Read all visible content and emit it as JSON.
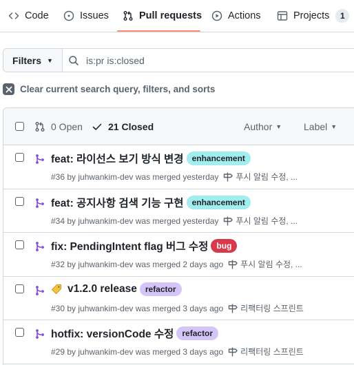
{
  "nav": {
    "tabs": [
      {
        "label": "Code",
        "icon": "code-icon"
      },
      {
        "label": "Issues",
        "icon": "issue-opened-icon"
      },
      {
        "label": "Pull requests",
        "icon": "git-pull-request-icon",
        "active": true
      },
      {
        "label": "Actions",
        "icon": "play-icon"
      },
      {
        "label": "Projects",
        "icon": "table-icon",
        "count": "1"
      }
    ]
  },
  "filter": {
    "button_label": "Filters",
    "query": "is:pr is:closed"
  },
  "clear_label": "Clear current search query, filters, and sorts",
  "list_header": {
    "open_label": "0 Open",
    "closed_label": "21 Closed",
    "author_label": "Author",
    "label_label": "Label"
  },
  "pull_requests": [
    {
      "title": "feat: 라이선스 보기 방식 변경",
      "label": {
        "name": "enhancement",
        "bg": "#a2eeef",
        "fg": "#1f2328"
      },
      "meta": "#36 by juhwankim-dev was merged yesterday",
      "milestone": "푸시 알림 수정, ..."
    },
    {
      "title": "feat: 공지사항 검색 기능 구현",
      "label": {
        "name": "enhancement",
        "bg": "#a2eeef",
        "fg": "#1f2328"
      },
      "meta": "#34 by juhwankim-dev was merged yesterday",
      "milestone": "푸시 알림 수정, ..."
    },
    {
      "title": "fix: PendingIntent flag 버그 수정",
      "label": {
        "name": "bug",
        "bg": "#d73a4a",
        "fg": "#ffffff"
      },
      "meta": "#32 by juhwankim-dev was merged 2 days ago",
      "milestone": "푸시 알림 수정, ..."
    },
    {
      "title": "v1.2.0 release",
      "tag_icon": true,
      "label": {
        "name": "refactor",
        "bg": "#d4c5f9",
        "fg": "#1f2328"
      },
      "meta": "#30 by juhwankim-dev was merged 3 days ago",
      "milestone": "리팩터링 스프린트"
    },
    {
      "title": "hotfix: versionCode 수정",
      "label": {
        "name": "refactor",
        "bg": "#d4c5f9",
        "fg": "#1f2328"
      },
      "meta": "#29 by juhwankim-dev was merged 3 days ago",
      "milestone": "리팩터링 스프린트"
    }
  ],
  "colors": {
    "merged": "#8250df",
    "underline": "#fd8c73"
  }
}
